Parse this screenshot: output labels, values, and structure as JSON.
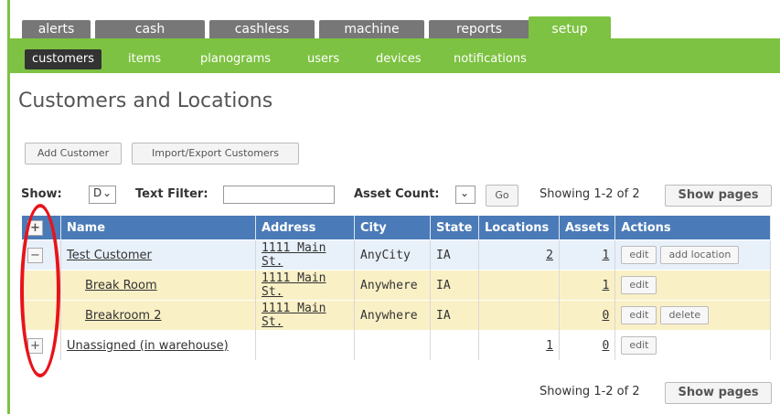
{
  "tabs": [
    "alerts",
    "cash",
    "cashless",
    "machine",
    "reports",
    "setup"
  ],
  "subtabs": [
    "customers",
    "items",
    "planograms",
    "users",
    "devices",
    "notifications"
  ],
  "title": "Customers and Locations",
  "buttons": {
    "add": "Add Customer",
    "import": "Import/Export Customers",
    "go": "Go",
    "show_pages": "Show pages"
  },
  "filters": {
    "show_label": "Show:",
    "show_value": "D",
    "text_filter_label": "Text Filter:",
    "asset_count_label": "Asset Count:"
  },
  "showing": "Showing 1-2 of 2",
  "table": {
    "headers": [
      "Name",
      "Address",
      "City",
      "State",
      "Locations",
      "Assets",
      "Actions"
    ],
    "rows": [
      {
        "type": "cust",
        "expander": "−",
        "name": "Test Customer",
        "address": "1111 Main St.",
        "city": "AnyCity",
        "state": "IA",
        "locations": "2",
        "assets": "1",
        "actions": [
          "edit",
          "add location"
        ]
      },
      {
        "type": "loc",
        "expander": "",
        "name": "Break Room",
        "address": "1111 Main St.",
        "city": "Anywhere",
        "state": "IA",
        "locations": "",
        "assets": "1",
        "actions": [
          "edit"
        ]
      },
      {
        "type": "loc",
        "expander": "",
        "name": "Breakroom 2",
        "address": "1111 Main St.",
        "city": "Anywhere",
        "state": "IA",
        "locations": "",
        "assets": "0",
        "actions": [
          "edit",
          "delete"
        ]
      },
      {
        "type": "un",
        "expander": "+",
        "name": "Unassigned (in warehouse)",
        "address": "",
        "city": "",
        "state": "",
        "locations": "1",
        "assets": "0",
        "actions": [
          "edit"
        ]
      }
    ]
  },
  "header_expander": "+",
  "colors": {
    "green": "#7dc242",
    "header": "#4a7ab7",
    "highlight": "#e8131a"
  }
}
